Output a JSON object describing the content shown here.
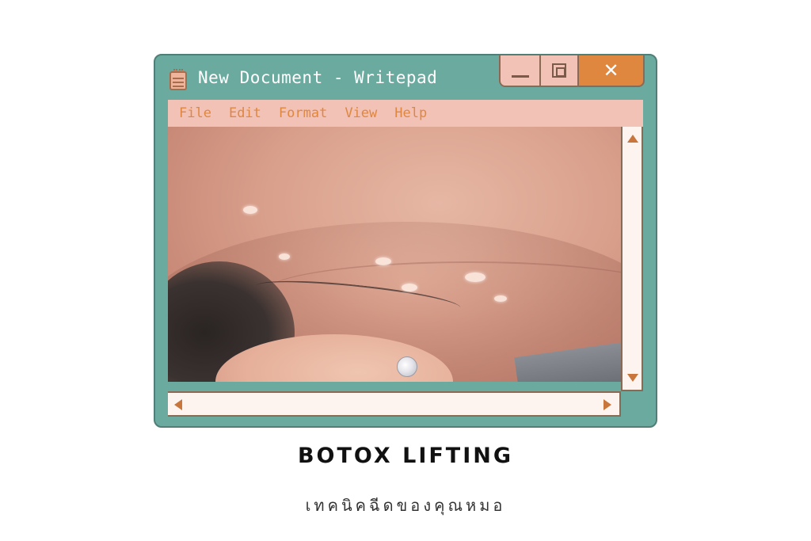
{
  "window": {
    "title": "New Document - Writepad",
    "controls": {
      "minimize": "minimize-icon",
      "maximize": "maximize-icon",
      "close_label": "✕"
    }
  },
  "menu": {
    "items": [
      "File",
      "Edit",
      "Format",
      "View",
      "Help"
    ]
  },
  "content": {
    "photo": "close-up-face-jawline-ear-earring"
  },
  "colors": {
    "window_frame": "#6aaa9f",
    "menubar": "#f2c2b6",
    "menu_text": "#e0873f",
    "close_button": "#e0873f",
    "scrollbar": "#fdf4f0"
  },
  "caption": {
    "headline": "BOTOX LIFTING",
    "subline": "เทคนิคฉีดของคุณหมอ"
  }
}
